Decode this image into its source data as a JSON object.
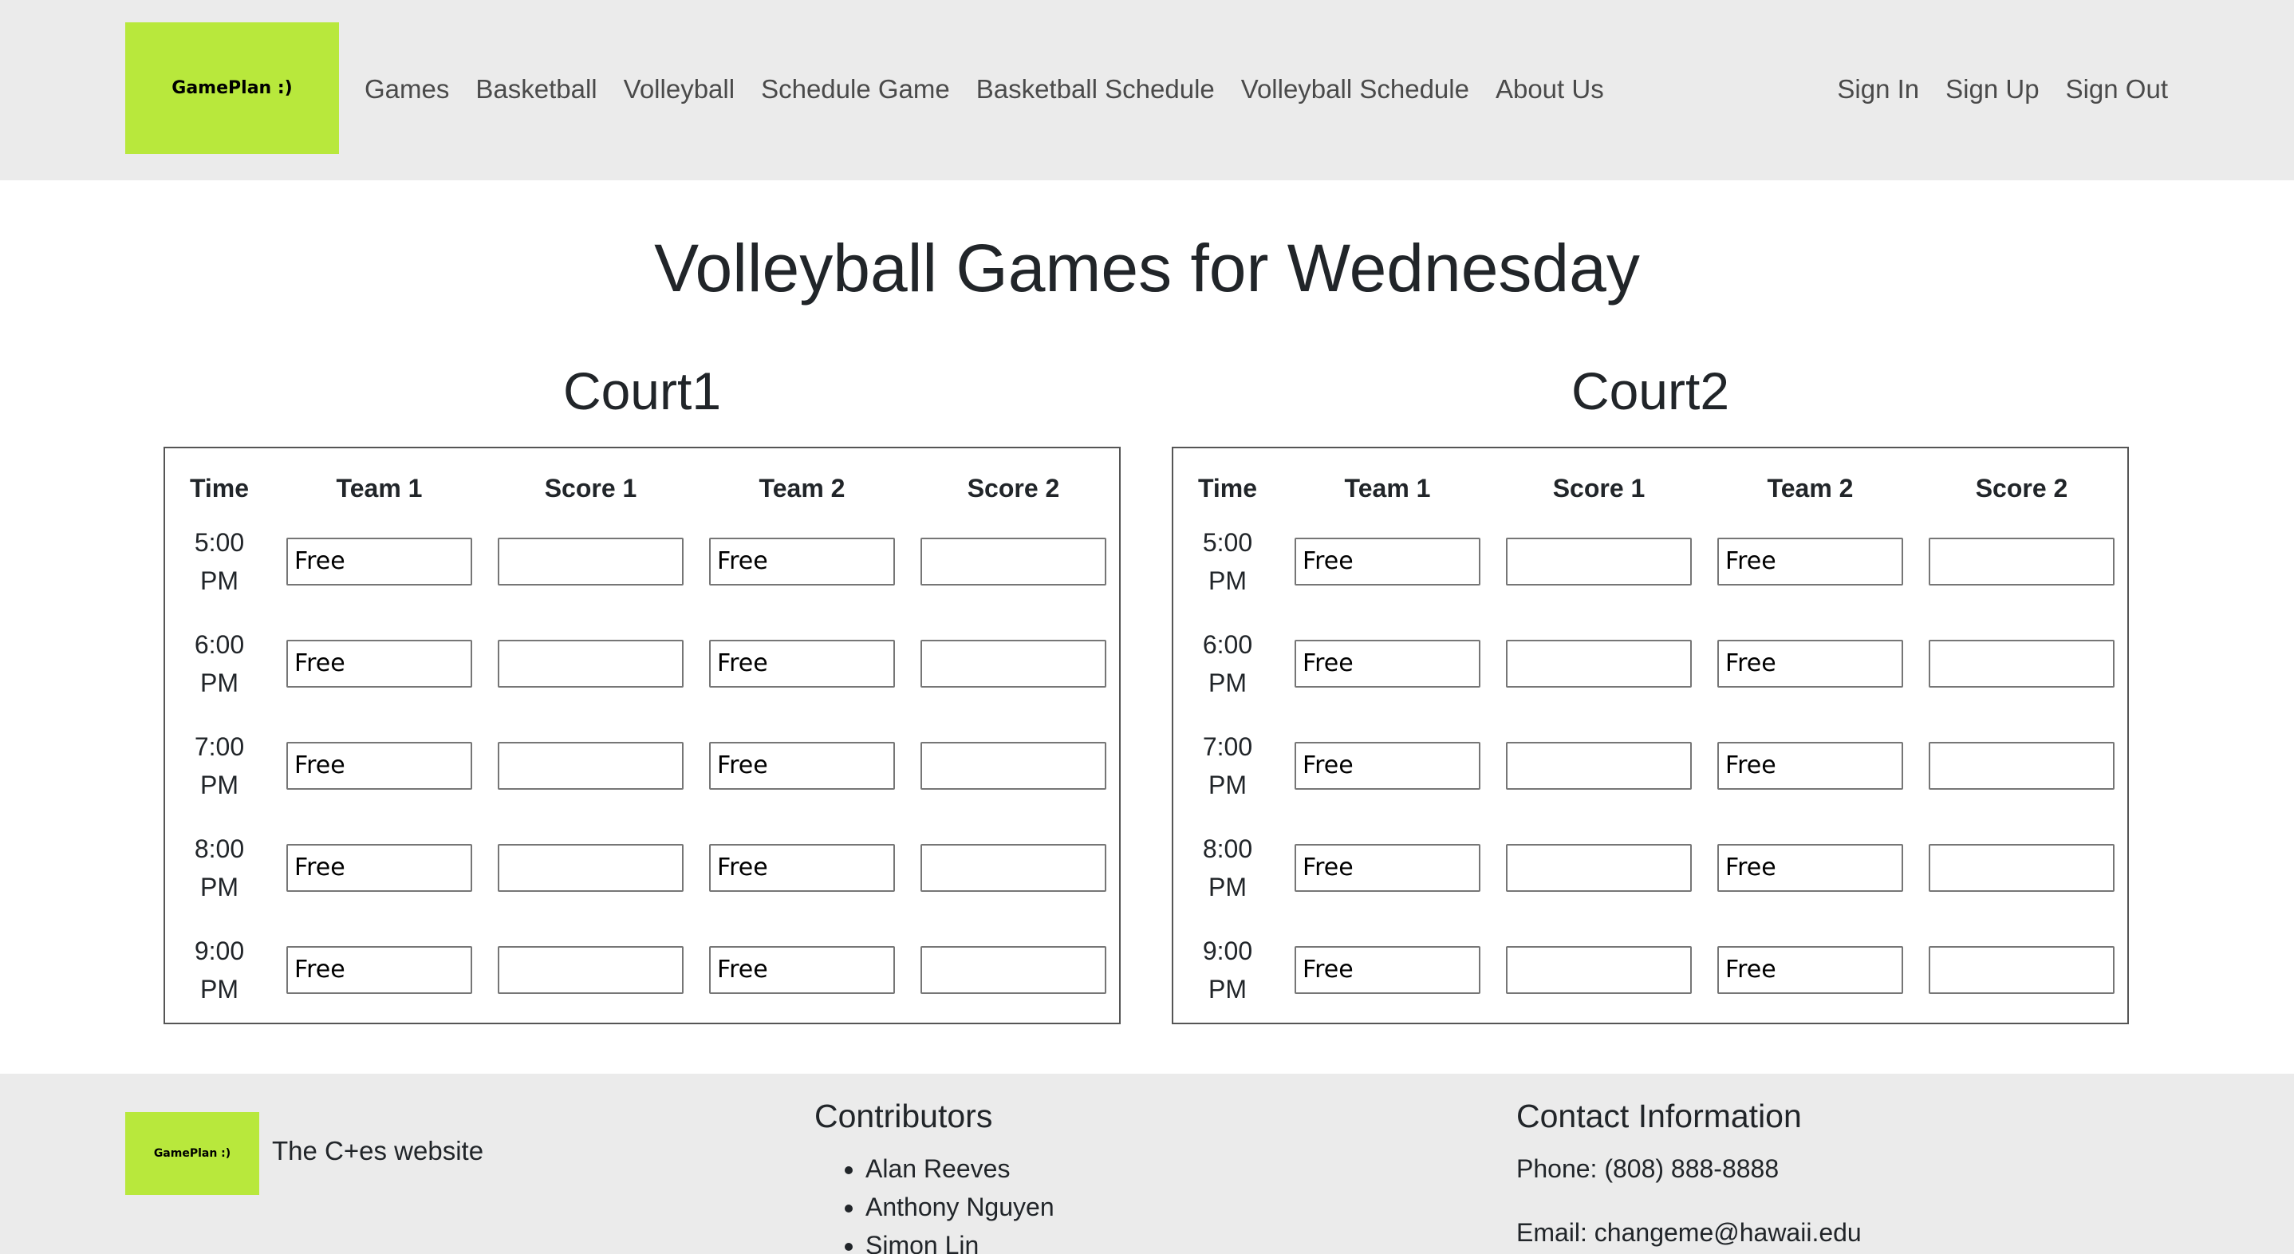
{
  "navbar": {
    "logo_text": "GamePlan :)",
    "links": [
      "Games",
      "Basketball",
      "Volleyball",
      "Schedule Game",
      "Basketball Schedule",
      "Volleyball Schedule",
      "About Us"
    ],
    "auth_links": [
      "Sign In",
      "Sign Up",
      "Sign Out"
    ]
  },
  "main": {
    "title": "Volleyball Games for Wednesday",
    "columns": [
      "Time",
      "Team 1",
      "Score 1",
      "Team 2",
      "Score 2"
    ],
    "courts": [
      {
        "name": "Court1",
        "rows": [
          {
            "time": [
              "5:00",
              "PM"
            ],
            "team1": "Free",
            "score1": "",
            "team2": "Free",
            "score2": ""
          },
          {
            "time": [
              "6:00",
              "PM"
            ],
            "team1": "Free",
            "score1": "",
            "team2": "Free",
            "score2": ""
          },
          {
            "time": [
              "7:00",
              "PM"
            ],
            "team1": "Free",
            "score1": "",
            "team2": "Free",
            "score2": ""
          },
          {
            "time": [
              "8:00",
              "PM"
            ],
            "team1": "Free",
            "score1": "",
            "team2": "Free",
            "score2": ""
          },
          {
            "time": [
              "9:00",
              "PM"
            ],
            "team1": "Free",
            "score1": "",
            "team2": "Free",
            "score2": ""
          }
        ]
      },
      {
        "name": "Court2",
        "rows": [
          {
            "time": [
              "5:00",
              "PM"
            ],
            "team1": "Free",
            "score1": "",
            "team2": "Free",
            "score2": ""
          },
          {
            "time": [
              "6:00",
              "PM"
            ],
            "team1": "Free",
            "score1": "",
            "team2": "Free",
            "score2": ""
          },
          {
            "time": [
              "7:00",
              "PM"
            ],
            "team1": "Free",
            "score1": "",
            "team2": "Free",
            "score2": ""
          },
          {
            "time": [
              "8:00",
              "PM"
            ],
            "team1": "Free",
            "score1": "",
            "team2": "Free",
            "score2": ""
          },
          {
            "time": [
              "9:00",
              "PM"
            ],
            "team1": "Free",
            "score1": "",
            "team2": "Free",
            "score2": ""
          }
        ]
      }
    ]
  },
  "footer": {
    "logo_text": "GamePlan :)",
    "tagline": "The C+es website",
    "contributors_heading": "Contributors",
    "contributors": [
      "Alan Reeves",
      "Anthony Nguyen",
      "Simon Lin"
    ],
    "contact_heading": "Contact Information",
    "phone": "Phone: (808) 888-8888",
    "email": "Email: changeme@hawaii.edu"
  },
  "colors": {
    "brand_green": "#b8e83c",
    "nav_bg": "#ebebeb"
  }
}
